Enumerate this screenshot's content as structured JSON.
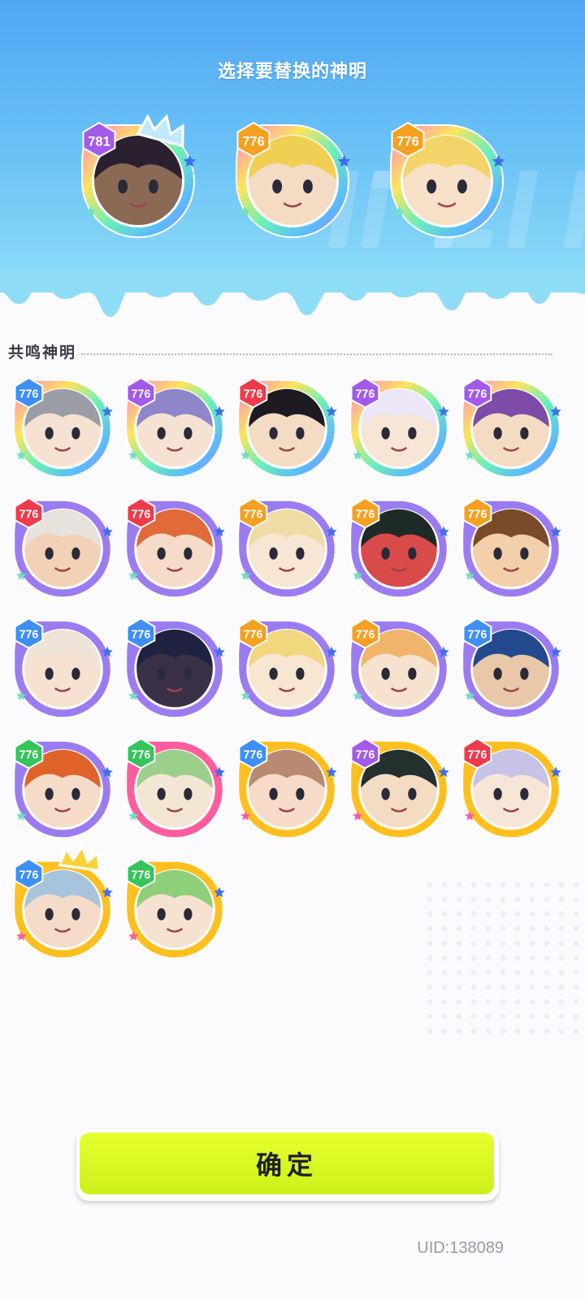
{
  "header": {
    "title": "选择要替换的神明"
  },
  "selected": [
    {
      "level": "781",
      "frame": "rainbow",
      "badge": "purple",
      "crown": "crystal-crown-icon",
      "skin": "#8a6a55",
      "hair": "#2a2030"
    },
    {
      "level": "776",
      "frame": "rainbow",
      "badge": "orange",
      "crown": "",
      "skin": "#f4dcc4",
      "hair": "#f1cf52"
    },
    {
      "level": "776",
      "frame": "rainbow",
      "badge": "orange",
      "crown": "",
      "skin": "#f7e0c8",
      "hair": "#f2d468"
    }
  ],
  "resonance": {
    "title": "共鸣神明",
    "gods": [
      {
        "level": "776",
        "frame": "rainbow",
        "badge": "blue",
        "hair": "#9a9ca6",
        "skin": "#f6e2d2"
      },
      {
        "level": "776",
        "frame": "rainbow",
        "badge": "purple",
        "hair": "#8d87c9",
        "skin": "#f6e2d2"
      },
      {
        "level": "776",
        "frame": "rainbow",
        "badge": "red",
        "hair": "#1e1a22",
        "skin": "#f4dcc4"
      },
      {
        "level": "776",
        "frame": "rainbow",
        "badge": "purple",
        "hair": "#ece6f6",
        "skin": "#f7e6d6"
      },
      {
        "level": "776",
        "frame": "rainbow",
        "badge": "purple",
        "hair": "#7d4ca8",
        "skin": "#f4dcc4"
      },
      {
        "level": "776",
        "frame": "purple",
        "badge": "red",
        "hair": "#e8e2dc",
        "skin": "#f2d2b6"
      },
      {
        "level": "776",
        "frame": "purple",
        "badge": "red",
        "hair": "#e06a3a",
        "skin": "#f6dcc8"
      },
      {
        "level": "776",
        "frame": "purple",
        "badge": "orange",
        "hair": "#efdca4",
        "skin": "#f7e6d4"
      },
      {
        "level": "776",
        "frame": "purple",
        "badge": "orange",
        "hair": "#1e2a26",
        "skin": "#d94a4a"
      },
      {
        "level": "776",
        "frame": "purple",
        "badge": "orange",
        "hair": "#7a4a2a",
        "skin": "#f3cfaa"
      },
      {
        "level": "776",
        "frame": "purple",
        "badge": "blue",
        "hair": "#f0e4d8",
        "skin": "#f7e2d2"
      },
      {
        "level": "776",
        "frame": "purple",
        "badge": "blue",
        "hair": "#1f2240",
        "skin": "#3a3046"
      },
      {
        "level": "776",
        "frame": "purple",
        "badge": "orange",
        "hair": "#f1d77e",
        "skin": "#f7e6d2"
      },
      {
        "level": "776",
        "frame": "purple",
        "badge": "orange",
        "hair": "#f0b46a",
        "skin": "#f7e2d0"
      },
      {
        "level": "776",
        "frame": "purple",
        "badge": "blue",
        "hair": "#234a8e",
        "skin": "#e8c8a8"
      },
      {
        "level": "776",
        "frame": "purple",
        "badge": "green",
        "hair": "#e0642a",
        "skin": "#f6dcc8"
      },
      {
        "level": "776",
        "frame": "pink",
        "badge": "green",
        "hair": "#9ccf8a",
        "skin": "#f4e6d4"
      },
      {
        "level": "776",
        "frame": "gold",
        "badge": "blue",
        "hair": "#b98a72",
        "skin": "#f6dcc8"
      },
      {
        "level": "776",
        "frame": "gold",
        "badge": "purple",
        "hair": "#23302e",
        "skin": "#f4dcc4"
      },
      {
        "level": "776",
        "frame": "gold",
        "badge": "red",
        "hair": "#c8c2e6",
        "skin": "#f7e6d8"
      },
      {
        "level": "776",
        "frame": "gold",
        "badge": "blue",
        "hair": "#a8c4dc",
        "skin": "#f4dcc8",
        "crown": "gold-crown-icon"
      },
      {
        "level": "776",
        "frame": "gold",
        "badge": "green",
        "hair": "#8ed07a",
        "skin": "#f6e2d0"
      }
    ]
  },
  "confirm_label": "确定",
  "uid": "UID:138089",
  "colors": {
    "badge": {
      "blue": "#3d8ff5",
      "purple": "#a35ae8",
      "red": "#ee3b4b",
      "orange": "#f5a020",
      "green": "#35c45a"
    },
    "frame": {
      "purple": "#9b7cf0",
      "gold": "#ffbf1f",
      "pink": "#ff5c9e"
    },
    "accent": "#d8f21e"
  }
}
